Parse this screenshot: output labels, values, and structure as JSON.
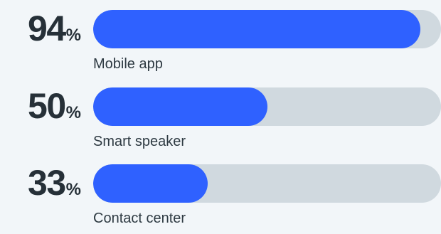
{
  "chart_data": {
    "type": "bar",
    "orientation": "horizontal",
    "title": "",
    "xlabel": "",
    "ylabel": "",
    "xlim": [
      0,
      100
    ],
    "unit": "%",
    "categories": [
      "Mobile app",
      "Smart speaker",
      "Contact center"
    ],
    "values": [
      94,
      50,
      33
    ],
    "bars": [
      {
        "label": "Mobile app",
        "value": 94,
        "value_text": "94",
        "unit": "%"
      },
      {
        "label": "Smart speaker",
        "value": 50,
        "value_text": "50",
        "unit": "%"
      },
      {
        "label": "Contact center",
        "value": 33,
        "value_text": "33",
        "unit": "%"
      }
    ],
    "grid": false,
    "legend": "none"
  },
  "colors": {
    "background": "#f2f6f9",
    "bar_fill": "#2f61ff",
    "bar_track": "#d0d9df",
    "value_text": "#263038",
    "label_text": "#2e3a42"
  }
}
